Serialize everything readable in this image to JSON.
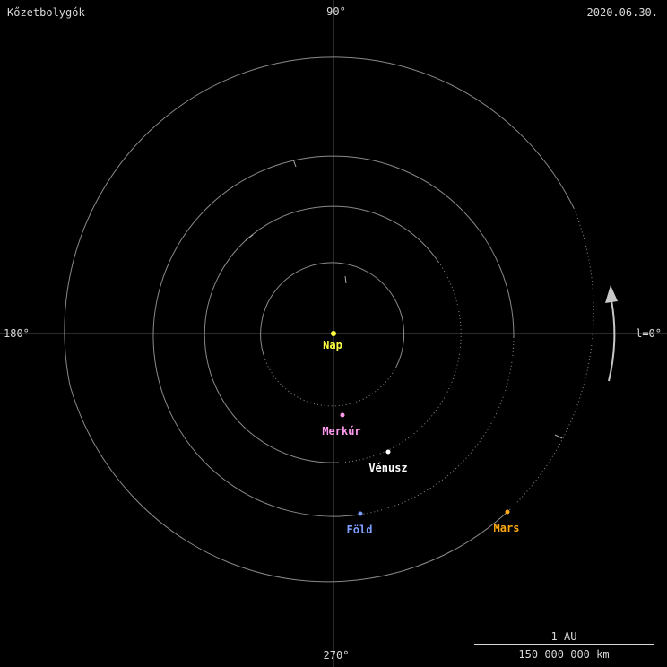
{
  "header": {
    "title": "Kőzetbolygók",
    "date": "2020.06.30."
  },
  "axes": {
    "top": "90°",
    "bottom": "270°",
    "left": "180°",
    "right": "l=0°"
  },
  "scale": {
    "label_top": "1 AU",
    "label_bottom": "150 000 000 km"
  },
  "colors": {
    "background": "#000000",
    "axis": "#555555",
    "orbit": "#8a8a8a",
    "text": "#d8d8d8",
    "arrow": "#c8c8c8"
  },
  "bodies": {
    "sun": {
      "label": "Nap",
      "color": "#ffff44"
    },
    "mercury": {
      "label": "Merkúr",
      "color": "#ff99ee"
    },
    "venus": {
      "label": "Vénusz",
      "color": "#ffffff"
    },
    "earth": {
      "label": "Föld",
      "color": "#7f9fff"
    },
    "mars": {
      "label": "Mars",
      "color": "#ffaa11"
    }
  },
  "direction_icon": "counterclockwise-arrow-icon"
}
